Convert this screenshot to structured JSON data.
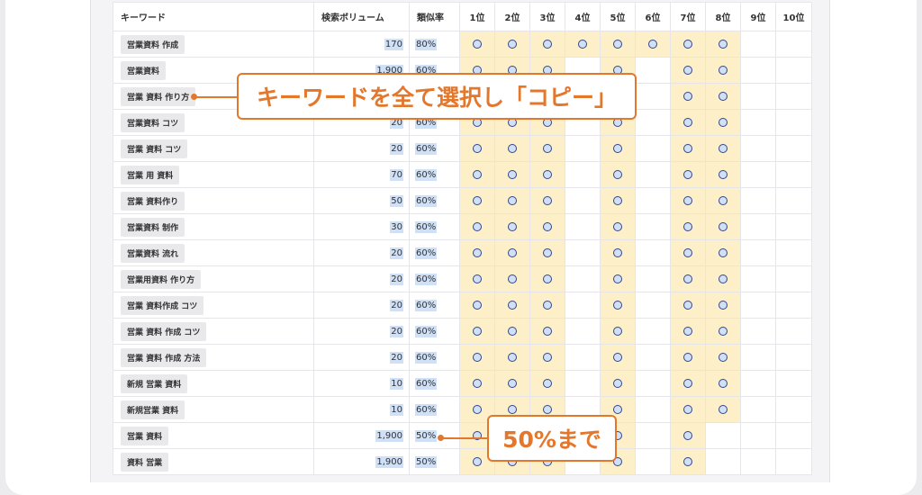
{
  "table": {
    "headers": [
      "キーワード",
      "検索ボリューム",
      "類似率",
      "1位",
      "2位",
      "3位",
      "4位",
      "5位",
      "6位",
      "7位",
      "8位",
      "9位",
      "10位"
    ],
    "rows": [
      {
        "keyword": "営業資料 作成",
        "volume": "170",
        "similarity": "80%",
        "ranks": [
          1,
          1,
          1,
          1,
          1,
          1,
          1,
          1,
          0,
          0
        ]
      },
      {
        "keyword": "営業資料",
        "volume": "1,900",
        "similarity": "60%",
        "ranks": [
          1,
          1,
          1,
          0,
          1,
          0,
          1,
          1,
          0,
          0
        ]
      },
      {
        "keyword": "営業 資料 作り方",
        "volume": "",
        "similarity": "",
        "ranks": [
          1,
          1,
          1,
          0,
          1,
          0,
          1,
          1,
          0,
          0
        ]
      },
      {
        "keyword": "営業資料 コツ",
        "volume": "20",
        "similarity": "60%",
        "ranks": [
          1,
          1,
          1,
          0,
          1,
          0,
          1,
          1,
          0,
          0
        ]
      },
      {
        "keyword": "営業 資料 コツ",
        "volume": "20",
        "similarity": "60%",
        "ranks": [
          1,
          1,
          1,
          0,
          1,
          0,
          1,
          1,
          0,
          0
        ]
      },
      {
        "keyword": "営業 用 資料",
        "volume": "70",
        "similarity": "60%",
        "ranks": [
          1,
          1,
          1,
          0,
          1,
          0,
          1,
          1,
          0,
          0
        ]
      },
      {
        "keyword": "営業 資料作り",
        "volume": "50",
        "similarity": "60%",
        "ranks": [
          1,
          1,
          1,
          0,
          1,
          0,
          1,
          1,
          0,
          0
        ]
      },
      {
        "keyword": "営業資料 制作",
        "volume": "30",
        "similarity": "60%",
        "ranks": [
          1,
          1,
          1,
          0,
          1,
          0,
          1,
          1,
          0,
          0
        ]
      },
      {
        "keyword": "営業資料 流れ",
        "volume": "20",
        "similarity": "60%",
        "ranks": [
          1,
          1,
          1,
          0,
          1,
          0,
          1,
          1,
          0,
          0
        ]
      },
      {
        "keyword": "営業用資料 作り方",
        "volume": "20",
        "similarity": "60%",
        "ranks": [
          1,
          1,
          1,
          0,
          1,
          0,
          1,
          1,
          0,
          0
        ]
      },
      {
        "keyword": "営業 資料作成 コツ",
        "volume": "20",
        "similarity": "60%",
        "ranks": [
          1,
          1,
          1,
          0,
          1,
          0,
          1,
          1,
          0,
          0
        ]
      },
      {
        "keyword": "営業 資料 作成 コツ",
        "volume": "20",
        "similarity": "60%",
        "ranks": [
          1,
          1,
          1,
          0,
          1,
          0,
          1,
          1,
          0,
          0
        ]
      },
      {
        "keyword": "営業 資料 作成 方法",
        "volume": "20",
        "similarity": "60%",
        "ranks": [
          1,
          1,
          1,
          0,
          1,
          0,
          1,
          1,
          0,
          0
        ]
      },
      {
        "keyword": "新規 営業 資料",
        "volume": "10",
        "similarity": "60%",
        "ranks": [
          1,
          1,
          1,
          0,
          1,
          0,
          1,
          1,
          0,
          0
        ]
      },
      {
        "keyword": "新規営業 資料",
        "volume": "10",
        "similarity": "60%",
        "ranks": [
          1,
          1,
          1,
          0,
          1,
          0,
          1,
          1,
          0,
          0
        ]
      },
      {
        "keyword": "営業 資料",
        "volume": "1,900",
        "similarity": "50%",
        "ranks": [
          1,
          1,
          1,
          0,
          1,
          0,
          1,
          0,
          0,
          0
        ]
      },
      {
        "keyword": "資料 営業",
        "volume": "1,900",
        "similarity": "50%",
        "ranks": [
          1,
          1,
          1,
          0,
          1,
          0,
          1,
          0,
          0,
          0
        ]
      }
    ]
  },
  "annotations": {
    "copy_callout": "キーワードを全て選択し「コピー」",
    "fifty_callout": "50%まで"
  },
  "colors": {
    "accent": "#e3772c",
    "rank_highlight": "#fdf0c9",
    "selection": "#cfe0f7",
    "circle_stroke": "#34448c"
  }
}
